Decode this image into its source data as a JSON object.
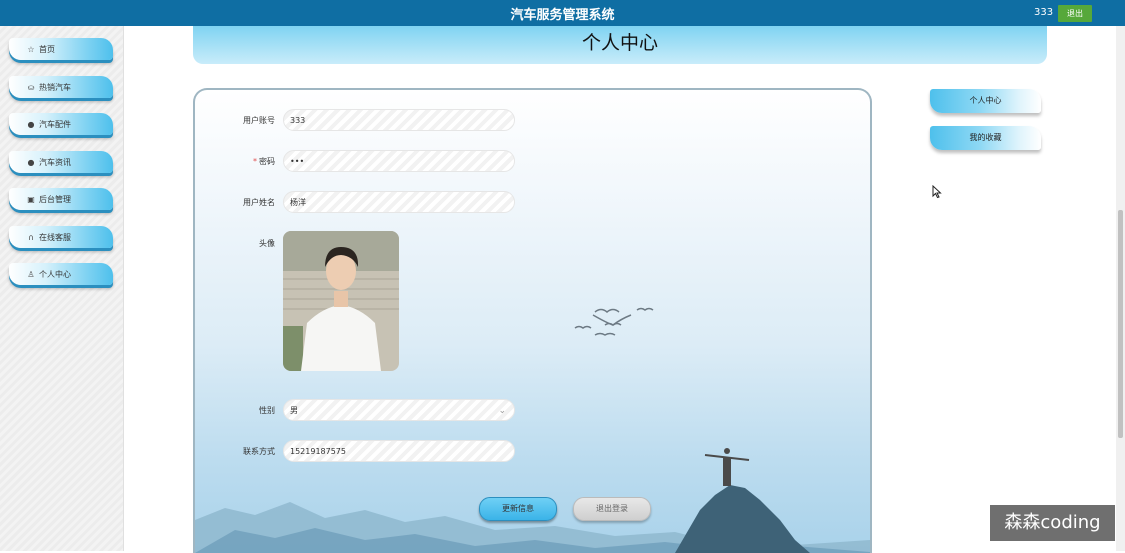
{
  "header": {
    "app_title": "汽车服务管理系统",
    "username": "333",
    "logout_label": "退出"
  },
  "sidebar": {
    "items": [
      {
        "label": "首页",
        "icon": "star-icon"
      },
      {
        "label": "热销汽车",
        "icon": "bag-icon"
      },
      {
        "label": "汽车配件",
        "icon": "info-icon"
      },
      {
        "label": "汽车资讯",
        "icon": "question-icon"
      },
      {
        "label": "后台管理",
        "icon": "briefcase-icon"
      },
      {
        "label": "在线客服",
        "icon": "headset-icon"
      },
      {
        "label": "个人中心",
        "icon": "user-icon"
      }
    ]
  },
  "page": {
    "title": "个人中心"
  },
  "form": {
    "username_label": "用户账号",
    "username_value": "333",
    "password_label": "密码",
    "password_required_mark": "*",
    "password_value": "•••",
    "name_label": "用户姓名",
    "name_value": "杨洋",
    "avatar_label": "头像",
    "gender_label": "性别",
    "gender_value": "男",
    "phone_label": "联系方式",
    "phone_value": "15219187575",
    "update_button": "更新信息",
    "logout_button": "退出登录"
  },
  "right_menu": {
    "items": [
      "个人中心",
      "我的收藏"
    ]
  },
  "watermark": {
    "text": "森森coding"
  },
  "colors": {
    "topbar": "#0f6ea3",
    "logout_button": "#56a83a",
    "accent_blue": "#4ec0ec"
  }
}
